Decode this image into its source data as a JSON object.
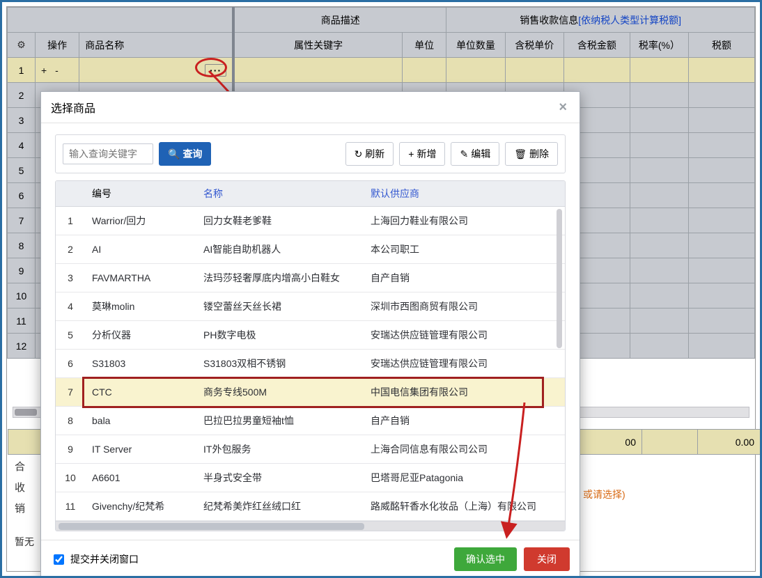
{
  "grid": {
    "header_group_left": "商品描述",
    "header_group_right_prefix": "销售收款信息",
    "header_group_right_link": "[依纳税人类型计算税额]",
    "cols": {
      "gear": "⚙",
      "op": "操作",
      "name": "商品名称",
      "attr": "属性关键字",
      "unit": "单位",
      "qty": "单位数量",
      "price": "含税单价",
      "amount": "含税金额",
      "rate": "税率(%）",
      "tax": "税额"
    },
    "row_plus": "+",
    "row_minus": "-",
    "ellipsis": "···",
    "footer_zero_amount": "00",
    "footer_zero_tax": "0.00"
  },
  "bottom": {
    "l1": "合",
    "l2": "收",
    "l3": "销",
    "l2_orange": "或请选择)",
    "nohist": "暂无"
  },
  "modal": {
    "title": "选择商品",
    "search_placeholder": "输入查询关键字",
    "query_btn": "查询",
    "refresh": "刷新",
    "add": "新增",
    "edit": "编辑",
    "delete": "删除",
    "cols": {
      "code": "编号",
      "name": "名称",
      "supplier": "默认供应商"
    },
    "rows": [
      {
        "idx": "1",
        "code": "Warrior/回力",
        "name": "回力女鞋老爹鞋",
        "sup": "上海回力鞋业有限公司"
      },
      {
        "idx": "2",
        "code": "AI",
        "name": "AI智能自助机器人",
        "sup": "本公司职工"
      },
      {
        "idx": "3",
        "code": "FAVMARTHA",
        "name": "法玛莎轻奢厚底内增高小白鞋女",
        "sup": "自产自销"
      },
      {
        "idx": "4",
        "code": "莫琳molin",
        "name": "镂空蕾丝天丝长裙",
        "sup": "深圳市西图商贸有限公司"
      },
      {
        "idx": "5",
        "code": "分析仪器",
        "name": "PH数字电极",
        "sup": "安瑞达供应链管理有限公司"
      },
      {
        "idx": "6",
        "code": "S31803",
        "name": "S31803双相不锈钢",
        "sup": "安瑞达供应链管理有限公司"
      },
      {
        "idx": "7",
        "code": "CTC",
        "name": "商务专线500M",
        "sup": "中国电信集团有限公司"
      },
      {
        "idx": "8",
        "code": "bala",
        "name": "巴拉巴拉男童短袖t恤",
        "sup": "自产自销"
      },
      {
        "idx": "9",
        "code": "IT Server",
        "name": "IT外包服务",
        "sup": "上海合同信息有限公司公司"
      },
      {
        "idx": "10",
        "code": "A6601",
        "name": "半身式安全带",
        "sup": "巴塔哥尼亚Patagonia"
      },
      {
        "idx": "11",
        "code": "Givenchy/纪梵希",
        "name": "纪梵希美炸红丝绒口红",
        "sup": "路威酩轩香水化妆品（上海）有限公司"
      }
    ],
    "selected_index": 6,
    "submit_close_label": "提交并关闭窗口",
    "confirm": "确认选中",
    "close": "关闭"
  },
  "icons": {
    "search": "🔍",
    "refresh": "↻",
    "plus": "+",
    "edit": "✎",
    "trash": "🗑"
  }
}
